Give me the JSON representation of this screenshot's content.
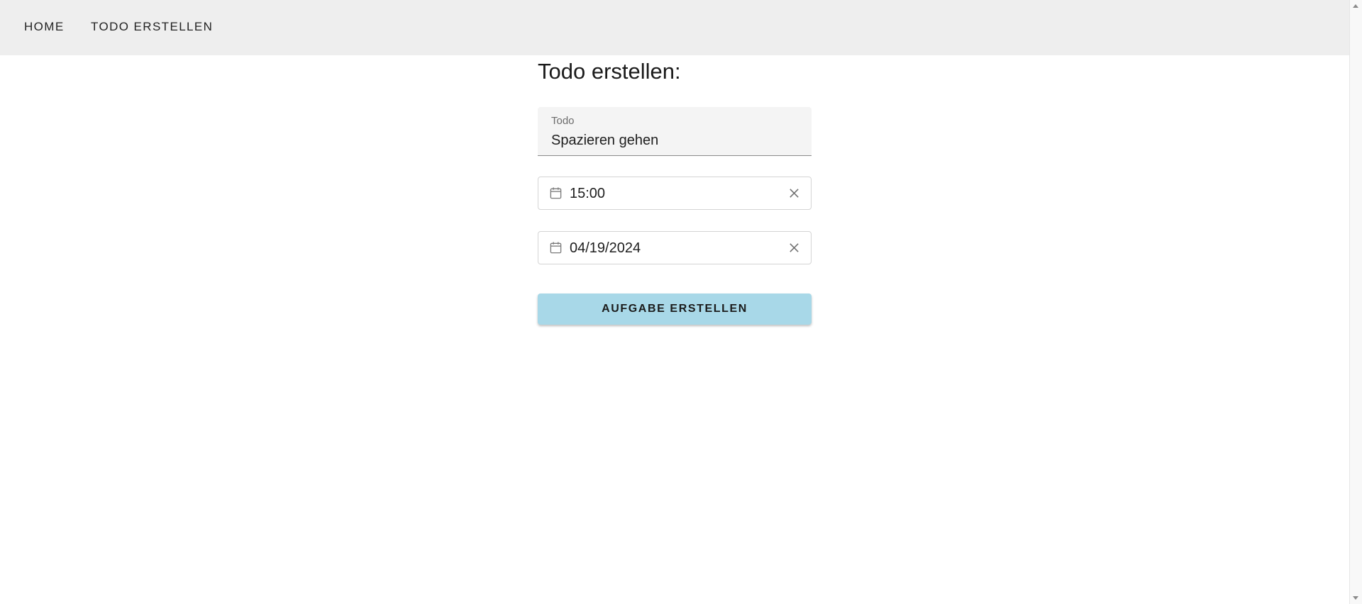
{
  "nav": {
    "home_label": "HOME",
    "create_label": "TODO ERSTELLEN"
  },
  "form": {
    "title": "Todo erstellen:",
    "todo_field": {
      "label": "Todo",
      "value": "Spazieren gehen"
    },
    "time_picker": {
      "value": "15:00",
      "icon": "calendar-icon",
      "clear_icon": "close-icon"
    },
    "date_picker": {
      "value": "04/19/2024",
      "icon": "calendar-icon",
      "clear_icon": "close-icon"
    },
    "submit_label": "AUFGABE ERSTELLEN"
  },
  "colors": {
    "navbar_bg": "#eeeeee",
    "button_bg": "#a8d8e8",
    "field_bg": "#f4f4f4"
  }
}
